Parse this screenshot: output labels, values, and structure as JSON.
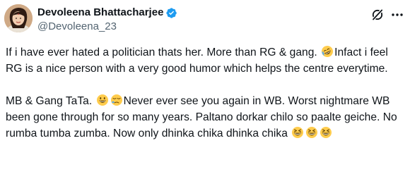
{
  "author": {
    "display_name": "Devoleena Bhattacharjee",
    "handle": "@Devoleena_23",
    "verified": true,
    "verified_color": "#1d9bf0"
  },
  "actions": {
    "grok_icon": "grok-icon",
    "more_icon": "more-icon"
  },
  "post": {
    "p1_a": "If i have ever hated a politician thats her. More than RG & gang. ",
    "p1_emoji": "rolling-on-floor-laughing",
    "p1_b": "Infact i feel RG is a nice person with a very good humor which helps the centre everytime.",
    "p2_a": "MB & Gang TaTa. ",
    "p2_emoji1": "smiling-face-with-open-mouth",
    "p2_emoji2": "sleeping-face",
    "p2_b": "Never ever see you again in WB. Worst nightmare WB been gone through for so many years. Paltano dorkar chilo so paalte geiche. No rumba tumba zumba. Now only dhinka chika dhinka chika ",
    "p2_emoji3": "grinning-squinting-face",
    "p2_emoji4": "grinning-squinting-face",
    "p2_emoji5": "grinning-squinting-face"
  },
  "colors": {
    "text": "#0f1419",
    "secondary": "#536471",
    "background": "#ffffff"
  }
}
